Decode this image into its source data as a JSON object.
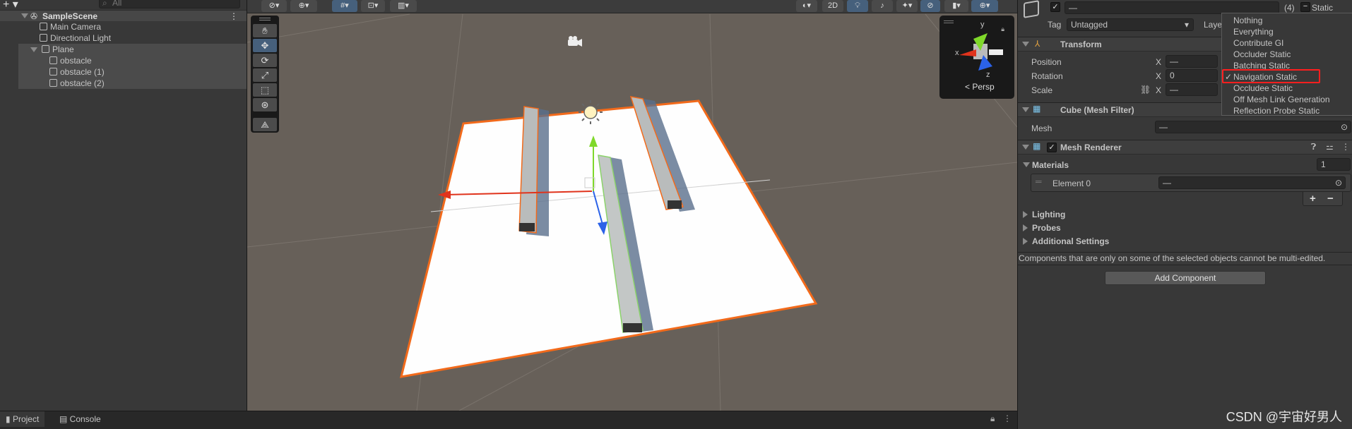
{
  "hierarchy": {
    "search_placeholder": "All",
    "scene": "SampleScene",
    "items": [
      {
        "label": "Main Camera"
      },
      {
        "label": "Directional Light"
      },
      {
        "label": "Plane"
      },
      {
        "label": "obstacle"
      },
      {
        "label": "obstacle (1)"
      },
      {
        "label": "obstacle (2)"
      }
    ]
  },
  "scene_view": {
    "toolbar": {
      "twod_label": "2D"
    },
    "tools": [
      "hand",
      "move",
      "rotate",
      "scale",
      "rect",
      "transform",
      "custom"
    ],
    "active_tool": "move",
    "gizmo": {
      "x": "x",
      "y": "y",
      "z": "z",
      "projection": "Persp"
    },
    "colors": {
      "selection_outline": "#f26a1b",
      "x_axis": "#e0331c",
      "y_axis": "#7fd82a",
      "z_axis": "#2b62e8"
    }
  },
  "bottom": {
    "tabs": [
      {
        "label": "Project"
      },
      {
        "label": "Console"
      }
    ]
  },
  "inspector": {
    "name_value": "—",
    "count": "(4)",
    "static_label": "Static",
    "tag_label": "Tag",
    "tag_value": "Untagged",
    "layer_label": "Layer",
    "transform": {
      "title": "Transform",
      "position": "Position",
      "rotation": "Rotation",
      "scale": "Scale",
      "axis": "X",
      "position_x": "—",
      "rotation_x": "0",
      "scale_x": "—"
    },
    "mesh_filter": {
      "title": "Cube (Mesh Filter)",
      "mesh_label": "Mesh",
      "mesh_value": "—"
    },
    "mesh_renderer": {
      "title": "Mesh Renderer",
      "materials": "Materials",
      "materials_count": "1",
      "element0": "Element 0",
      "element0_value": "—",
      "plus": "+",
      "minus": "−",
      "lighting": "Lighting",
      "probes": "Probes",
      "additional": "Additional Settings"
    },
    "message": "Components that are only on some of the selected objects cannot be multi-edited.",
    "add_component": "Add Component"
  },
  "static_dropdown": {
    "items": [
      {
        "label": "Nothing",
        "checked": false
      },
      {
        "label": "Everything",
        "checked": false
      },
      {
        "label": "Contribute GI",
        "checked": false
      },
      {
        "label": "Occluder Static",
        "checked": false
      },
      {
        "label": "Batching Static",
        "checked": false
      },
      {
        "label": "Navigation Static",
        "checked": true
      },
      {
        "label": "Occludee Static",
        "checked": false
      },
      {
        "label": "Off Mesh Link Generation",
        "checked": false
      },
      {
        "label": "Reflection Probe Static",
        "checked": false
      }
    ],
    "highlight_color": "#ff1f1f"
  },
  "watermark": "CSDN @宇宙好男人"
}
